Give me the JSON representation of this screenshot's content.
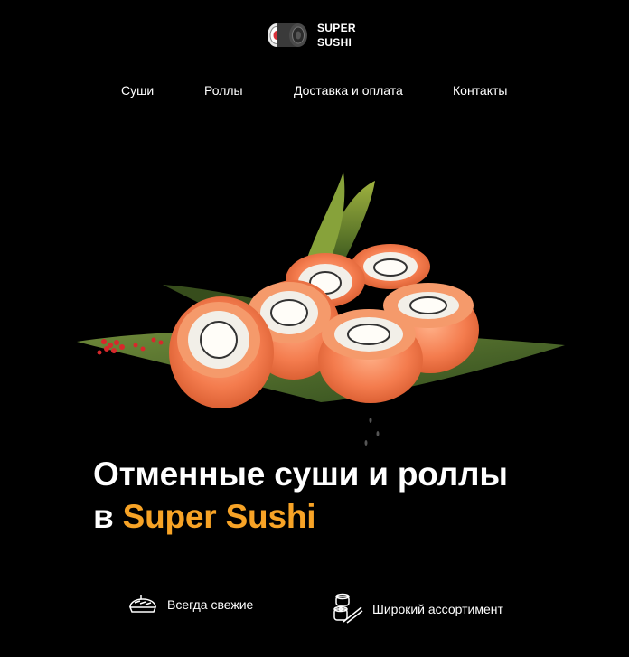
{
  "brand": {
    "line1": "SUPER",
    "line2": "SUSHI"
  },
  "nav": [
    "Суши",
    "Роллы",
    "Доставка и оплата",
    "Контакты"
  ],
  "hero": {
    "title_line1": "Отменные суши и роллы",
    "title_prefix": "в",
    "title_accent": "Super Sushi"
  },
  "features": [
    {
      "icon": "sushi-nigiri-icon",
      "label": "Всегда свежие"
    },
    {
      "icon": "sushi-roll-chopsticks-icon",
      "label": "Широкий ассортимент"
    }
  ],
  "colors": {
    "accent": "#f7a326",
    "background": "#000000"
  }
}
